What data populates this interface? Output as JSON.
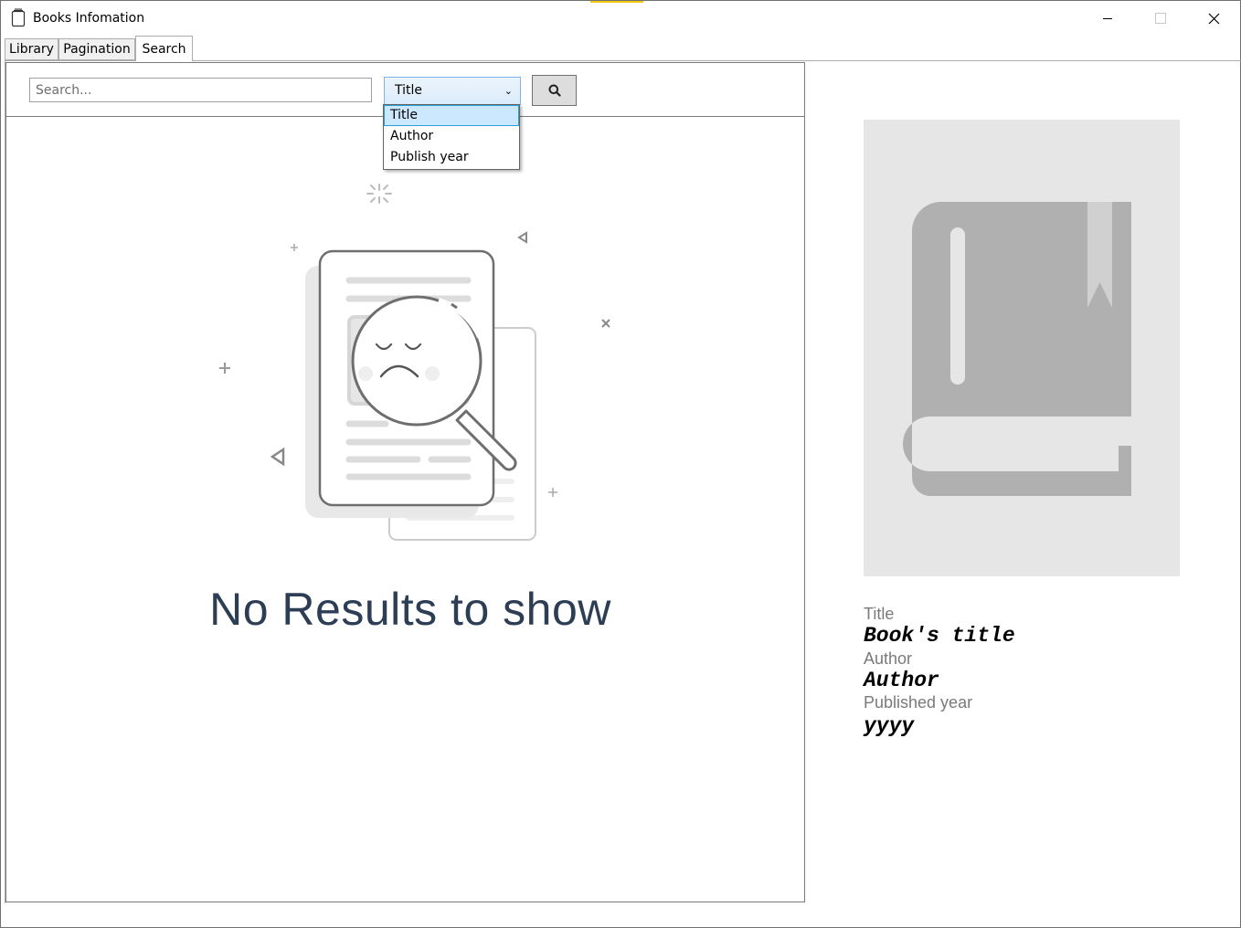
{
  "window": {
    "title": "Books Infomation",
    "controls": {
      "minimize": "minimize-icon",
      "maximize": "maximize-icon",
      "close": "close-icon"
    }
  },
  "tabs": [
    {
      "label": "Library",
      "active": false
    },
    {
      "label": "Pagination",
      "active": false
    },
    {
      "label": "Search",
      "active": true
    }
  ],
  "search": {
    "placeholder": "Search...",
    "value": "",
    "filter_selected": "Title",
    "filter_options": [
      "Title",
      "Author",
      "Publish year"
    ],
    "dropdown_open": true,
    "button_icon": "search-icon"
  },
  "results": {
    "empty_message": "No Results to show",
    "empty_icon": "sad-magnifier-document-illustration"
  },
  "details": {
    "cover_icon": "book-icon",
    "title_label": "Title",
    "title_value": "Book's title",
    "author_label": "Author",
    "author_value": "Author",
    "year_label": "Published year",
    "year_value": "yyyy"
  },
  "colors": {
    "accent": "#f2c811",
    "empty_text": "#2c3e55",
    "cover_bg": "#e6e6e6",
    "cover_icon": "#b0b0b0",
    "dropdown_highlight": "#cce8ff"
  }
}
